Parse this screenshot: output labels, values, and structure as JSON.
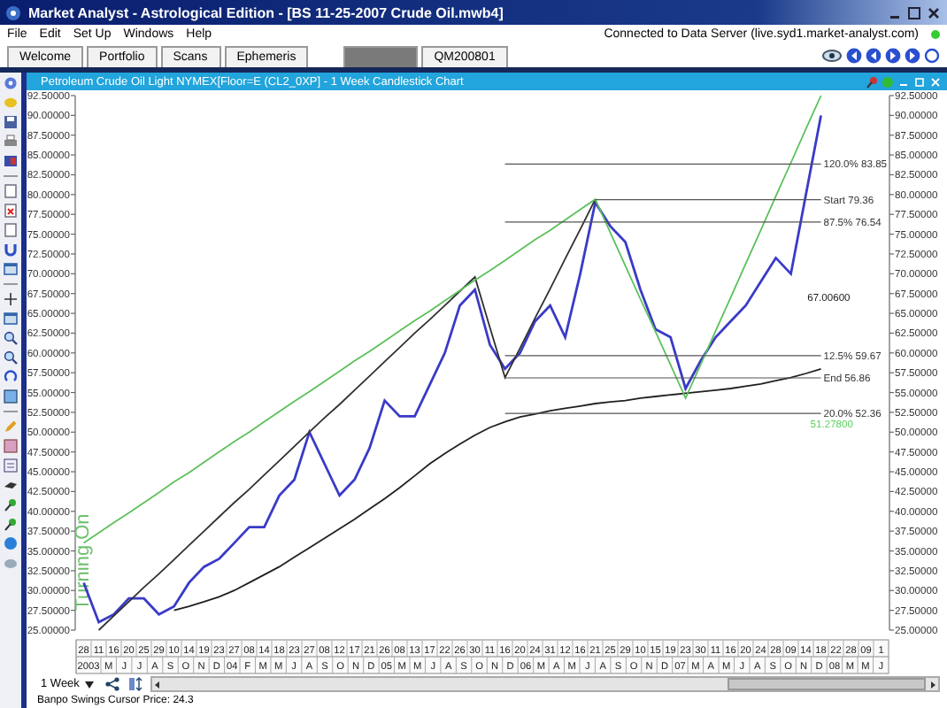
{
  "window": {
    "title": "Market Analyst - Astrological Edition - [BS 11-25-2007 Crude Oil.mwb4]"
  },
  "menu": [
    "File",
    "Edit",
    "Set Up",
    "Windows",
    "Help"
  ],
  "connection_status": "Connected to Data Server (live.syd1.market-analyst.com)",
  "tabs": [
    {
      "label": "Welcome",
      "selected": false
    },
    {
      "label": "Portfolio",
      "selected": false
    },
    {
      "label": "Scans",
      "selected": false
    },
    {
      "label": "Ephemeris",
      "selected": false
    },
    {
      "selected": true
    },
    {
      "label": "QM200801",
      "selected": false
    }
  ],
  "chart_window": {
    "title": "Petroleum Crude Oil Light NYMEX[Floor=E (CL2_0XP] - 1 Week Candlestick Chart",
    "side_label": "Turning On",
    "chart_data": {
      "type": "line",
      "ylim": [
        25,
        92.5
      ],
      "categories": [
        "28",
        "11",
        "16",
        "20",
        "25",
        "29",
        "10",
        "14",
        "19",
        "23",
        "27",
        "08",
        "14",
        "18",
        "23",
        "27",
        "08",
        "12",
        "17",
        "21",
        "26",
        "08",
        "13",
        "17",
        "22",
        "26",
        "30",
        "11",
        "16",
        "20",
        "24",
        "31",
        "12",
        "16",
        "21",
        "25",
        "29",
        "10",
        "15",
        "19",
        "23",
        "30",
        "11",
        "16",
        "20",
        "24",
        "28",
        "09",
        "14",
        "18",
        "22",
        "28",
        "09",
        "1"
      ],
      "series": [
        {
          "color": "#3a3ac8",
          "values": [
            31,
            26,
            27,
            29,
            29,
            27,
            28,
            31,
            33,
            34,
            36,
            38,
            38,
            42,
            44,
            50,
            46,
            42,
            44,
            48,
            54,
            52,
            52,
            56,
            60,
            66,
            68,
            61,
            58,
            60,
            64,
            66,
            62,
            70,
            79,
            76,
            74,
            68,
            63,
            62,
            55.5,
            59,
            62,
            64,
            66,
            69,
            72,
            70,
            80,
            90,
            null,
            null,
            null,
            null
          ]
        },
        {
          "color": "#202020",
          "values": [
            null,
            null,
            null,
            null,
            null,
            null,
            27.5,
            28,
            28.6,
            29.2,
            30,
            31,
            32,
            33,
            34.2,
            35.4,
            36.6,
            37.8,
            39,
            40.3,
            41.6,
            43,
            44.5,
            46,
            47.3,
            48.5,
            49.6,
            50.6,
            51.3,
            51.9,
            52.3,
            52.7,
            53,
            53.3,
            53.6,
            53.8,
            54,
            54.3,
            54.5,
            54.7,
            54.9,
            55.1,
            55.3,
            55.5,
            55.8,
            56.1,
            56.5,
            56.9,
            57.4,
            58,
            null,
            null,
            null,
            null
          ]
        },
        {
          "color": "#303030",
          "values": [
            null,
            25,
            26.8,
            28.6,
            30.4,
            32.1,
            33.9,
            35.7,
            37.5,
            39.3,
            41.1,
            42.8,
            44.6,
            46.4,
            48.2,
            50,
            51.8,
            53.5,
            55.3,
            57.1,
            58.9,
            60.7,
            62.5,
            64.2,
            66,
            67.8,
            69.6,
            63.2,
            56.9,
            60.6,
            64.4,
            68.1,
            71.9,
            75.6,
            79.4,
            null,
            null,
            null,
            null,
            null,
            null,
            null,
            null,
            null,
            null,
            null,
            null,
            null,
            null,
            null,
            null,
            null,
            null,
            null
          ]
        },
        {
          "color": "#5cc05c",
          "values": [
            36,
            37.3,
            38.6,
            39.8,
            41.1,
            42.4,
            43.7,
            44.9,
            46.2,
            47.5,
            48.8,
            50,
            51.3,
            52.6,
            53.9,
            55.1,
            56.4,
            57.7,
            59,
            60.2,
            61.5,
            62.8,
            64.1,
            65.3,
            66.6,
            67.9,
            69.2,
            70.4,
            71.7,
            73,
            74.3,
            75.5,
            76.8,
            78.1,
            79.4,
            75.2,
            71,
            66.8,
            62.7,
            58.5,
            54.3,
            58.5,
            62.8,
            67,
            71.3,
            75.5,
            79.8,
            84,
            88.3,
            92.5,
            null,
            null,
            null,
            null
          ]
        },
        {
          "name": "120.0% 83.85",
          "color": "#555555",
          "values": [
            null,
            null,
            null,
            null,
            null,
            null,
            null,
            null,
            null,
            null,
            null,
            null,
            null,
            null,
            null,
            null,
            null,
            null,
            null,
            null,
            null,
            null,
            null,
            null,
            null,
            null,
            null,
            null,
            83.85,
            83.85,
            83.85,
            83.85,
            83.85,
            83.85,
            83.85,
            83.85,
            83.85,
            83.85,
            83.85,
            83.85,
            83.85,
            83.85,
            83.85,
            83.85,
            83.85,
            83.85,
            83.85,
            83.85,
            83.85,
            83.85,
            null,
            null,
            null,
            null
          ]
        },
        {
          "name": "Start 79.36",
          "color": "#555555",
          "values": [
            null,
            null,
            null,
            null,
            null,
            null,
            null,
            null,
            null,
            null,
            null,
            null,
            null,
            null,
            null,
            null,
            null,
            null,
            null,
            null,
            null,
            null,
            null,
            null,
            null,
            null,
            null,
            null,
            null,
            null,
            null,
            null,
            null,
            null,
            79.36,
            79.36,
            79.36,
            79.36,
            79.36,
            79.36,
            79.36,
            79.36,
            79.36,
            79.36,
            79.36,
            79.36,
            79.36,
            79.36,
            79.36,
            79.36,
            null,
            null,
            null,
            null
          ]
        },
        {
          "name": "87.5% 76.54",
          "color": "#555555",
          "values": [
            null,
            null,
            null,
            null,
            null,
            null,
            null,
            null,
            null,
            null,
            null,
            null,
            null,
            null,
            null,
            null,
            null,
            null,
            null,
            null,
            null,
            null,
            null,
            null,
            null,
            null,
            null,
            null,
            76.54,
            76.54,
            76.54,
            76.54,
            76.54,
            76.54,
            76.54,
            76.54,
            76.54,
            76.54,
            76.54,
            76.54,
            76.54,
            76.54,
            76.54,
            76.54,
            76.54,
            76.54,
            76.54,
            76.54,
            76.54,
            76.54,
            null,
            null,
            null,
            null
          ]
        },
        {
          "name": "12.5% 59.67",
          "color": "#555555",
          "values": [
            null,
            null,
            null,
            null,
            null,
            null,
            null,
            null,
            null,
            null,
            null,
            null,
            null,
            null,
            null,
            null,
            null,
            null,
            null,
            null,
            null,
            null,
            null,
            null,
            null,
            null,
            null,
            null,
            59.67,
            59.67,
            59.67,
            59.67,
            59.67,
            59.67,
            59.67,
            59.67,
            59.67,
            59.67,
            59.67,
            59.67,
            59.67,
            59.67,
            59.67,
            59.67,
            59.67,
            59.67,
            59.67,
            59.67,
            59.67,
            59.67,
            null,
            null,
            null,
            null
          ]
        },
        {
          "name": "End 56.86",
          "color": "#555555",
          "values": [
            null,
            null,
            null,
            null,
            null,
            null,
            null,
            null,
            null,
            null,
            null,
            null,
            null,
            null,
            null,
            null,
            null,
            null,
            null,
            null,
            null,
            null,
            null,
            null,
            null,
            null,
            null,
            null,
            56.86,
            56.86,
            56.86,
            56.86,
            56.86,
            56.86,
            56.86,
            56.86,
            56.86,
            56.86,
            56.86,
            56.86,
            56.86,
            56.86,
            56.86,
            56.86,
            56.86,
            56.86,
            56.86,
            56.86,
            56.86,
            56.86,
            null,
            null,
            null,
            null
          ]
        },
        {
          "name": "20.0% 52.36",
          "color": "#555555",
          "values": [
            null,
            null,
            null,
            null,
            null,
            null,
            null,
            null,
            null,
            null,
            null,
            null,
            null,
            null,
            null,
            null,
            null,
            null,
            null,
            null,
            null,
            null,
            null,
            null,
            null,
            null,
            null,
            null,
            52.36,
            52.36,
            52.36,
            52.36,
            52.36,
            52.36,
            52.36,
            52.36,
            52.36,
            52.36,
            52.36,
            52.36,
            52.36,
            52.36,
            52.36,
            52.36,
            52.36,
            52.36,
            52.36,
            52.36,
            52.36,
            52.36,
            null,
            null,
            null,
            null
          ]
        }
      ],
      "yticks": [
        {
          "value": 92.5,
          "label": "92.50000"
        },
        {
          "value": 90,
          "label": "90.00000"
        },
        {
          "value": 87.5,
          "label": "87.50000"
        },
        {
          "value": 85,
          "label": "85.00000"
        },
        {
          "value": 82.5,
          "label": "82.50000"
        },
        {
          "value": 80,
          "label": "80.00000"
        },
        {
          "value": 77.5,
          "label": "77.50000"
        },
        {
          "value": 75,
          "label": "75.00000"
        },
        {
          "value": 72.5,
          "label": "72.50000"
        },
        {
          "value": 70,
          "label": "70.00000"
        },
        {
          "value": 67.5,
          "label": "67.50000"
        },
        {
          "value": 65,
          "label": "65.00000"
        },
        {
          "value": 62.5,
          "label": "62.50000"
        },
        {
          "value": 60,
          "label": "60.00000"
        },
        {
          "value": 57.5,
          "label": "57.50000"
        },
        {
          "value": 55,
          "label": "55.00000"
        },
        {
          "value": 52.5,
          "label": "52.50000"
        },
        {
          "value": 50,
          "label": "50.00000"
        },
        {
          "value": 47.5,
          "label": "47.50000"
        },
        {
          "value": 45,
          "label": "45.00000"
        },
        {
          "value": 42.5,
          "label": "42.50000"
        },
        {
          "value": 40,
          "label": "40.00000"
        },
        {
          "value": 37.5,
          "label": "37.50000"
        },
        {
          "value": 35,
          "label": "35.00000"
        },
        {
          "value": 32.5,
          "label": "32.50000"
        },
        {
          "value": 30,
          "label": "30.00000"
        },
        {
          "value": 27.5,
          "label": "27.50000"
        },
        {
          "value": 25,
          "label": "25.00000"
        }
      ],
      "annotations": [
        "67.00600",
        "51.27800"
      ]
    },
    "month_labels": [
      "2003",
      "M",
      "J",
      "J",
      "A",
      "S",
      "O",
      "N",
      "D",
      "04",
      "F",
      "M",
      "M",
      "J",
      "A",
      "S",
      "O",
      "N",
      "D",
      "05",
      "M",
      "M",
      "J",
      "A",
      "S",
      "O",
      "N",
      "D",
      "06",
      "M",
      "A",
      "M",
      "J",
      "A",
      "S",
      "O",
      "N",
      "D",
      "07",
      "M",
      "A",
      "M",
      "J",
      "A",
      "S",
      "O",
      "N",
      "D",
      "08",
      "M",
      "M",
      "J"
    ],
    "period": "1 Week"
  },
  "status_bar": "Banpo Swings Cursor Price: 24.3"
}
